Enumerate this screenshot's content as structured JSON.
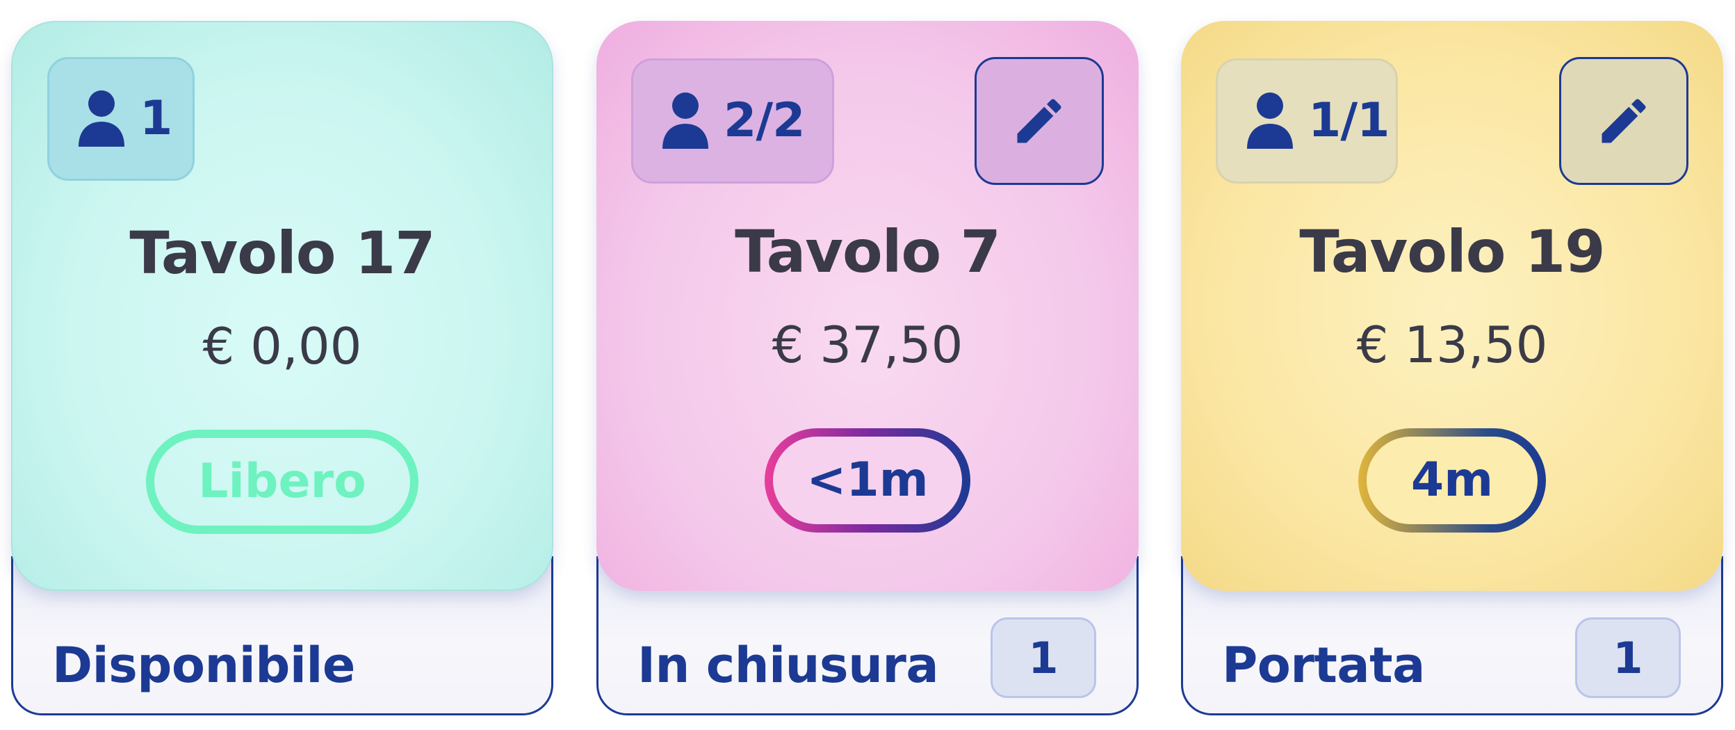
{
  "tables": [
    {
      "guests": "1",
      "name": "Tavolo 17",
      "amount": "€ 0,00",
      "status_pill": "Libero",
      "strip_label": "Disponibile"
    },
    {
      "guests": "2/2",
      "name": "Tavolo 7",
      "amount": "€ 37,50",
      "status_pill": "<1m",
      "strip_label": "In chiusura",
      "count": "1"
    },
    {
      "guests": "1/1",
      "name": "Tavolo 19",
      "amount": "€ 13,50",
      "status_pill": "4m",
      "strip_label": "Portata",
      "count": "1"
    }
  ],
  "icons": {
    "guest": "person-icon",
    "edit": "pencil-icon"
  },
  "colors": {
    "primary_text": "#1c3a93",
    "title_text": "#3a3a48",
    "free_green": "#6ef2bf",
    "card_free": "#ccf6f1",
    "card_closing": "#f4c8ea",
    "card_course": "#fbe7a4"
  }
}
